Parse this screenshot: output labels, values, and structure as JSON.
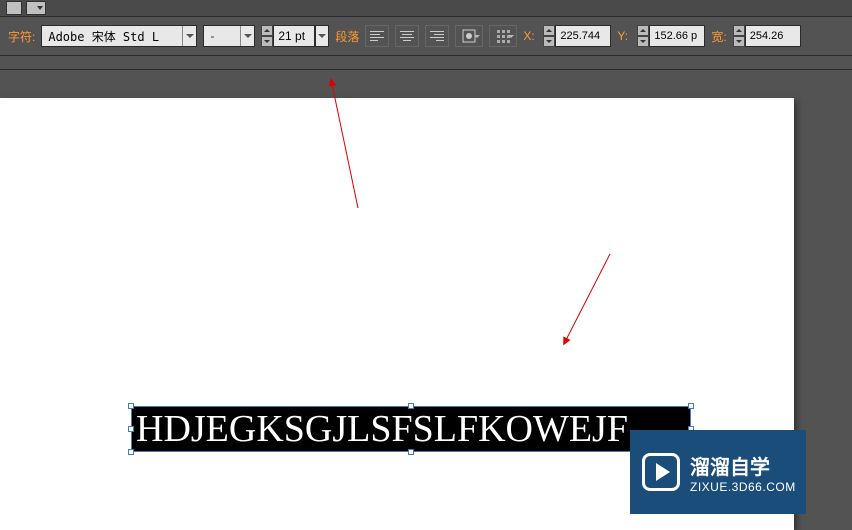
{
  "toolbar": {
    "char_label": "字符:",
    "font_family": "Adobe 宋体 Std L",
    "font_style": "-",
    "font_size": "21 pt",
    "paragraph_label": "段落",
    "x_label": "X:",
    "x_value": "225.744",
    "y_label": "Y:",
    "y_value": "152.66 p",
    "w_label": "宽:",
    "w_value": "254.26"
  },
  "text_frame": {
    "content": "HDJEGKSGJLSFSLFKOWEJF"
  },
  "watermark": {
    "brand": "溜溜自学",
    "url": "ZIXUE.3D66.COM"
  }
}
